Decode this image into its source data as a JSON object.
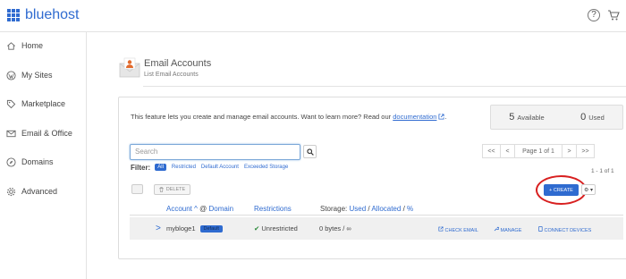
{
  "brand": {
    "name": "bluehost"
  },
  "topbar": {
    "help_glyph": "?",
    "icons": [
      "help-icon",
      "cart-icon"
    ]
  },
  "sidebar": {
    "items": [
      {
        "label": "Home",
        "icon": "home-icon"
      },
      {
        "label": "My Sites",
        "icon": "wordpress-icon"
      },
      {
        "label": "Marketplace",
        "icon": "tag-icon"
      },
      {
        "label": "Email & Office",
        "icon": "envelope-icon"
      },
      {
        "label": "Domains",
        "icon": "compass-icon"
      },
      {
        "label": "Advanced",
        "icon": "gear-icon"
      }
    ]
  },
  "page": {
    "title": "Email Accounts",
    "breadcrumb": "List Email Accounts"
  },
  "intro": {
    "text": "This feature lets you create and manage email accounts. Want to learn more? Read our",
    "link": "documentation",
    "end": "."
  },
  "stats": {
    "available_count": "5",
    "available_label": "Available",
    "used_count": "0",
    "used_label": "Used"
  },
  "search": {
    "placeholder": "Search"
  },
  "pager": {
    "first": "<<",
    "prev": "<",
    "page": "Page 1 of 1",
    "next": ">",
    "last": ">>"
  },
  "filter": {
    "label": "Filter:",
    "options": [
      {
        "label": "All",
        "active": true
      },
      {
        "label": "Restricted",
        "active": false
      },
      {
        "label": "Default Account",
        "active": false
      },
      {
        "label": "Exceeded Storage",
        "active": false
      }
    ]
  },
  "count": "1 - 1 of 1",
  "toolbar": {
    "delete_label": "DELETE",
    "create_label": "+ CREATE",
    "gear_label": "⚙ ▾"
  },
  "table": {
    "headers": {
      "account": "Account",
      "sort_arrow": "^",
      "at": "@",
      "domain": "Domain",
      "restrictions": "Restrictions",
      "storage_prefix": "Storage:",
      "used": "Used",
      "slash1": "/",
      "allocated": "Allocated",
      "slash2": "/",
      "percent": "%"
    },
    "rows": [
      {
        "expand": ">",
        "account": "mybloge1",
        "badge": "Default",
        "restriction_icon": "✔",
        "restriction": "Unrestricted",
        "storage": "0 bytes / ∞",
        "actions": [
          "CHECK EMAIL",
          "MANAGE",
          "CONNECT DEVICES"
        ]
      }
    ]
  },
  "colors": {
    "accent": "#2f6bd0",
    "highlight_ring": "#d82020",
    "restriction_ok": "#2c8a3a"
  }
}
